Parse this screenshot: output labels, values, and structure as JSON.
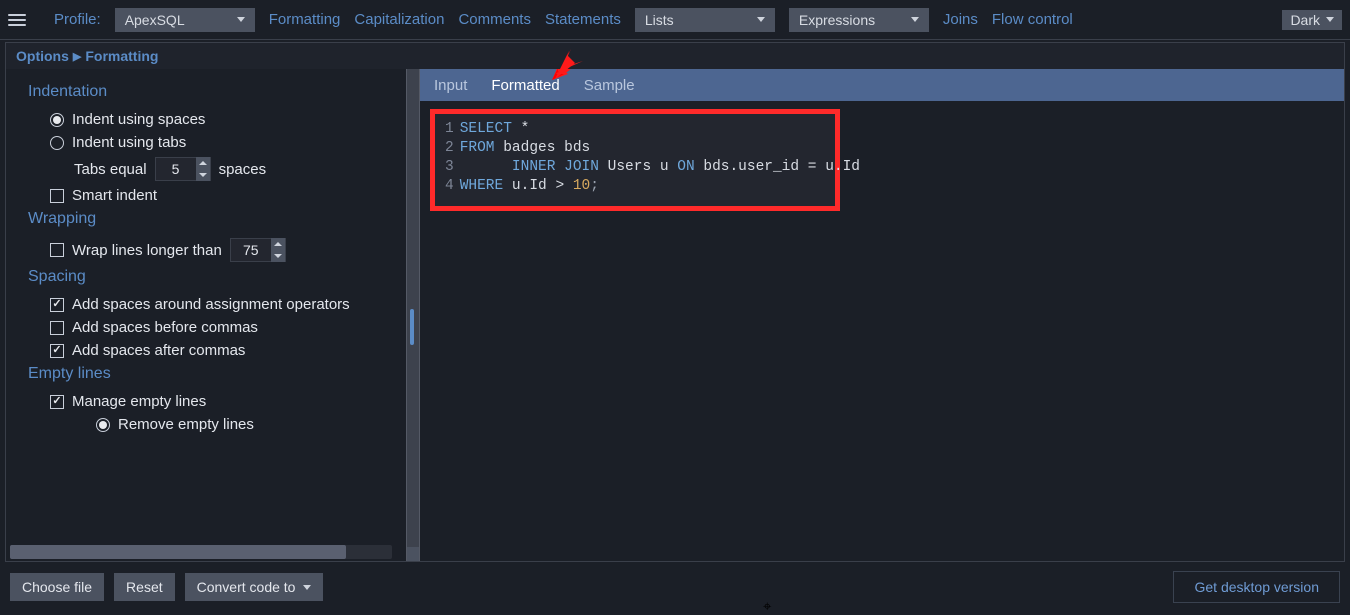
{
  "topbar": {
    "profile_label": "Profile:",
    "profile_value": "ApexSQL",
    "nav": [
      "Formatting",
      "Capitalization",
      "Comments",
      "Statements"
    ],
    "dd_lists": "Lists",
    "dd_expressions": "Expressions",
    "nav2": [
      "Joins",
      "Flow control"
    ],
    "theme": "Dark"
  },
  "breadcrumb": {
    "a": "Options",
    "b": "Formatting"
  },
  "options": {
    "sect_indentation": "Indentation",
    "indent_spaces": "Indent using spaces",
    "indent_tabs": "Indent using tabs",
    "tabs_equal_pre": "Tabs equal",
    "tabs_equal_val": "5",
    "tabs_equal_post": "spaces",
    "smart_indent": "Smart indent",
    "sect_wrapping": "Wrapping",
    "wrap_label": "Wrap lines longer than",
    "wrap_val": "75",
    "sect_spacing": "Spacing",
    "spacing_assign": "Add spaces around assignment operators",
    "spacing_before_commas": "Add spaces before commas",
    "spacing_after_commas": "Add spaces after commas",
    "sect_empty": "Empty lines",
    "manage_empty": "Manage empty lines",
    "remove_empty": "Remove empty lines"
  },
  "tabs": {
    "input": "Input",
    "formatted": "Formatted",
    "sample": "Sample"
  },
  "code": {
    "l1_kw": "SELECT",
    "l1_rest": " *",
    "l2_kw": "FROM",
    "l2_rest": " badges bds",
    "l3_pre": "      ",
    "l3_kw1": "INNER JOIN",
    "l3_mid": " Users u ",
    "l3_kw2": "ON",
    "l3_rest": " bds.user_id = u.Id",
    "l4_kw": "WHERE",
    "l4_a": " u.Id ",
    "l4_op": ">",
    "l4_b": " ",
    "l4_num": "10",
    "l4_end": ";"
  },
  "bottom": {
    "choose": "Choose file",
    "reset": "Reset",
    "convert": "Convert code to",
    "desktop": "Get desktop version"
  }
}
